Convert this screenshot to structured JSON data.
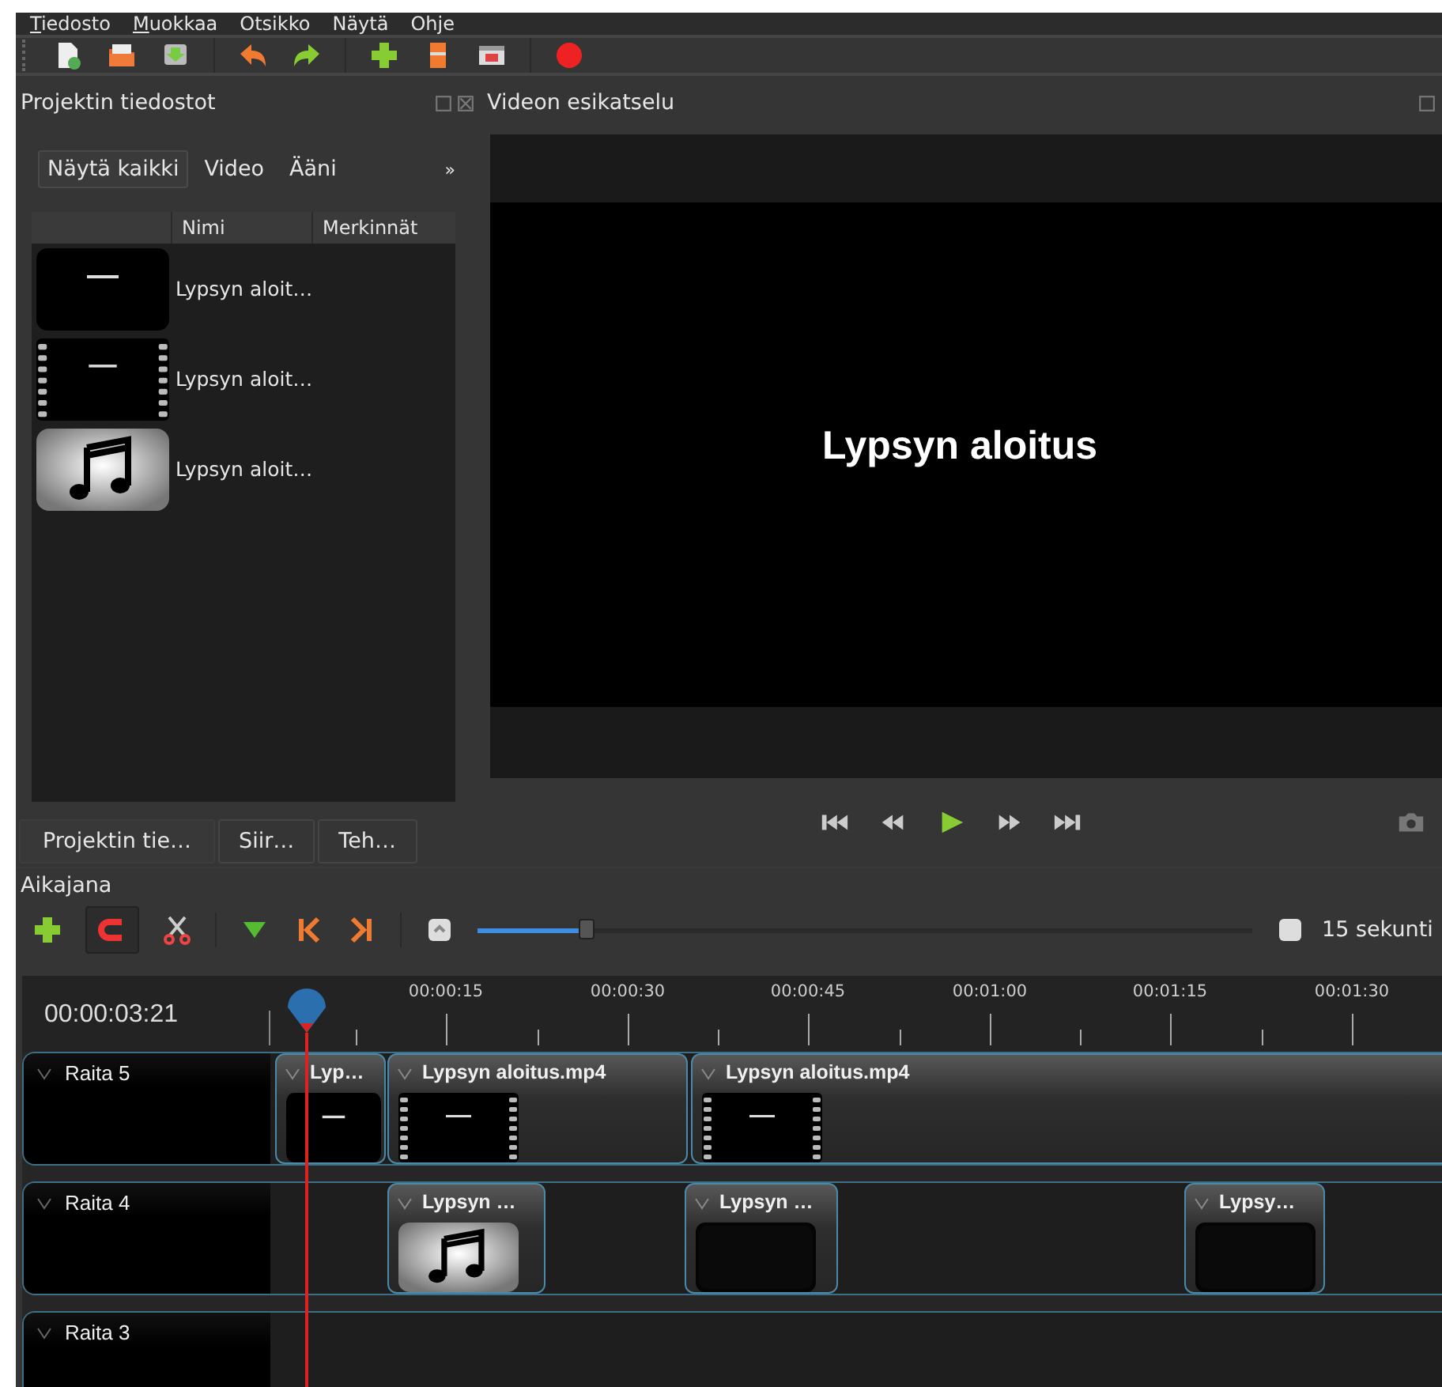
{
  "menu": [
    {
      "label": "Tiedosto",
      "mnemonic": true
    },
    {
      "label": "Muokkaa",
      "mnemonic": true
    },
    {
      "label": "Otsikko",
      "mnemonic": false
    },
    {
      "label": "Näytä",
      "mnemonic": false
    },
    {
      "label": "Ohje",
      "mnemonic": false
    }
  ],
  "files_panel": {
    "title": "Projektin tiedostot",
    "filters": [
      {
        "label": "Näytä kaikki",
        "selected": true
      },
      {
        "label": "Video",
        "selected": false
      },
      {
        "label": "Ääni",
        "selected": false
      }
    ],
    "more": "»",
    "columns": [
      "Nimi",
      "Merkinnät"
    ],
    "rows": [
      {
        "name": "Lypsyn aloit…",
        "kind": "title"
      },
      {
        "name": "Lypsyn aloit…",
        "kind": "video"
      },
      {
        "name": "Lypsyn aloit…",
        "kind": "audio"
      }
    ],
    "tabs": [
      {
        "label": "Projektin tie…",
        "selected": true
      },
      {
        "label": "Siir…",
        "selected": false
      },
      {
        "label": "Teh…",
        "selected": false
      }
    ]
  },
  "preview": {
    "title": "Videon esikatselu",
    "caption": "Lypsyn aloitus"
  },
  "timeline": {
    "title": "Aikajana",
    "snapping": true,
    "zoom": {
      "level": 0.14,
      "label": "15 sekunti"
    },
    "timecode": "00:00:03:21",
    "ruler": [
      "00:00:15",
      "00:00:30",
      "00:00:45",
      "00:01:00",
      "00:01:15",
      "00:01:30"
    ],
    "tracks": [
      {
        "name": "Raita 5",
        "clips": [
          {
            "title": "Lyp…",
            "kind": "title"
          },
          {
            "title": "Lypsyn aloitus.mp4",
            "kind": "video"
          },
          {
            "title": "Lypsyn aloitus.mp4",
            "kind": "video"
          }
        ]
      },
      {
        "name": "Raita 4",
        "clips": [
          {
            "title": "Lypsyn …",
            "kind": "audio"
          },
          {
            "title": "Lypsyn …",
            "kind": "blank"
          },
          {
            "title": "Lypsy…",
            "kind": "blank"
          }
        ]
      },
      {
        "name": "Raita 3"
      }
    ]
  }
}
